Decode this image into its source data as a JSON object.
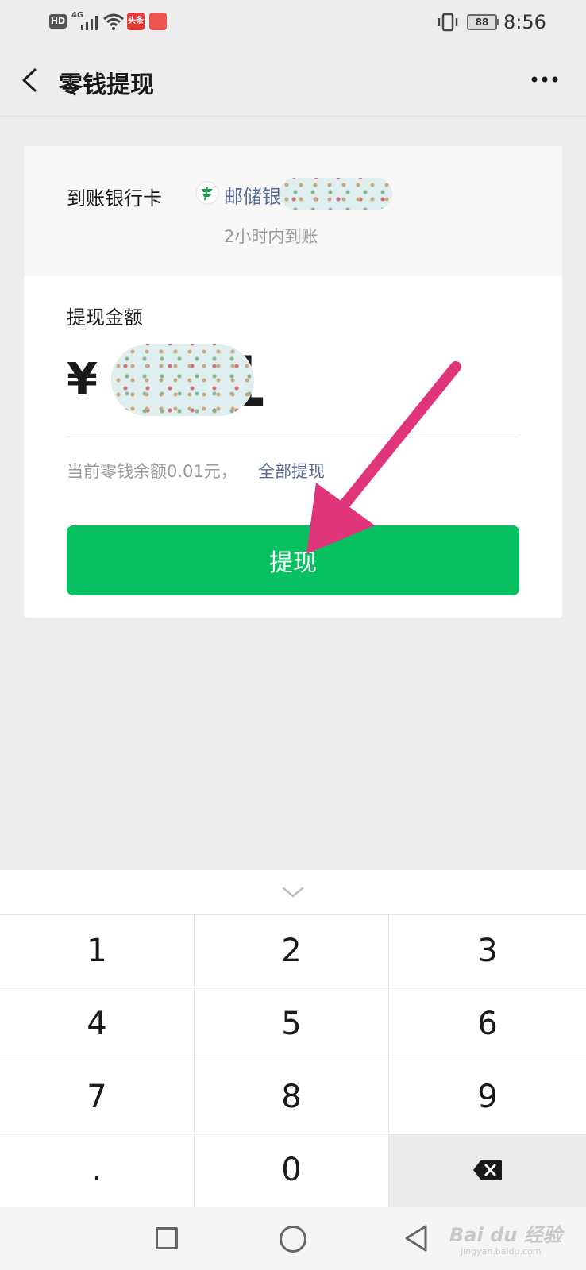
{
  "status_bar": {
    "hd": "HD",
    "network": "4G",
    "app_badge": "头条",
    "battery": "88",
    "time": "8:56"
  },
  "nav": {
    "title": "零钱提现"
  },
  "withdraw": {
    "bank_label": "到账银行卡",
    "bank_name": "邮储银",
    "arrival_time": "2小时内到账",
    "amount_label": "提现金额",
    "currency": "¥",
    "amount_visible": "1",
    "balance_text": "当前零钱余额0.01元，",
    "withdraw_all": "全部提现",
    "button_label": "提现"
  },
  "keypad": {
    "keys": [
      "1",
      "2",
      "3",
      "4",
      "5",
      "6",
      "7",
      "8",
      "9",
      ".",
      "0"
    ]
  },
  "watermark": {
    "brand": "Bai du 经验",
    "url": "jingyan.baidu.com"
  },
  "colors": {
    "primary_green": "#07c160",
    "link_blue": "#576b95",
    "annotation_arrow": "#e0357a"
  }
}
